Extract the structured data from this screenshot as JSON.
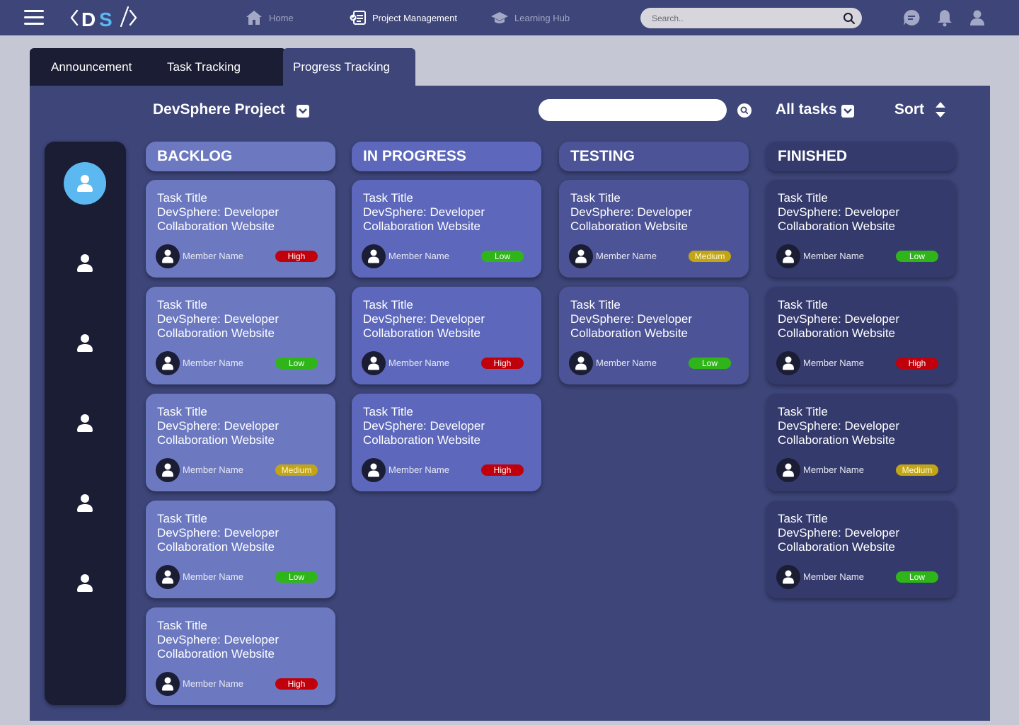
{
  "header": {
    "nav": [
      {
        "label": "Home",
        "icon": "home-icon",
        "active": false
      },
      {
        "label": "Project Management",
        "icon": "project-management-icon",
        "active": true
      },
      {
        "label": "Learning Hub",
        "icon": "graduation-cap-icon",
        "active": false
      }
    ],
    "search_placeholder": "Search.."
  },
  "tabs": [
    {
      "label": "Announcement",
      "active": false
    },
    {
      "label": "Task Tracking",
      "active": false
    },
    {
      "label": "Progress Tracking",
      "active": true
    }
  ],
  "board": {
    "project": "DevSphere Project",
    "search_value": "",
    "filter": "All tasks",
    "sort": "Sort"
  },
  "colors": {
    "high": "#c0000b",
    "low": "#2fb51a",
    "medium": "#c2a517",
    "accent": "#5bb8f0"
  },
  "columns": [
    {
      "name": "BACKLOG",
      "cards": [
        {
          "title": "Task Title",
          "desc": "DevSphere: Developer Collaboration Website",
          "member": "Member Name",
          "priority": "High"
        },
        {
          "title": "Task Title",
          "desc": "DevSphere: Developer Collaboration Website",
          "member": "Member Name",
          "priority": "Low"
        },
        {
          "title": "Task Title",
          "desc": "DevSphere: Developer Collaboration Website",
          "member": "Member Name",
          "priority": "Medium"
        },
        {
          "title": "Task Title",
          "desc": "DevSphere: Developer Collaboration Website",
          "member": "Member Name",
          "priority": "Low"
        },
        {
          "title": "Task Title",
          "desc": "DevSphere: Developer Collaboration Website",
          "member": "Member Name",
          "priority": "High"
        }
      ]
    },
    {
      "name": "IN PROGRESS",
      "cards": [
        {
          "title": "Task Title",
          "desc": "DevSphere: Developer Collaboration Website",
          "member": "Member Name",
          "priority": "Low"
        },
        {
          "title": "Task Title",
          "desc": "DevSphere: Developer Collaboration Website",
          "member": "Member Name",
          "priority": "High"
        },
        {
          "title": "Task Title",
          "desc": "DevSphere: Developer Collaboration Website",
          "member": "Member Name",
          "priority": "High"
        }
      ]
    },
    {
      "name": "TESTING",
      "cards": [
        {
          "title": "Task Title",
          "desc": "DevSphere: Developer Collaboration Website",
          "member": "Member Name",
          "priority": "Medium"
        },
        {
          "title": "Task Title",
          "desc": "DevSphere: Developer Collaboration Website",
          "member": "Member Name",
          "priority": "Low"
        }
      ]
    },
    {
      "name": "FINISHED",
      "cards": [
        {
          "title": "Task Title",
          "desc": "DevSphere: Developer Collaboration Website",
          "member": "Member Name",
          "priority": "Low"
        },
        {
          "title": "Task Title",
          "desc": "DevSphere: Developer Collaboration Website",
          "member": "Member Name",
          "priority": "High"
        },
        {
          "title": "Task Title",
          "desc": "DevSphere: Developer Collaboration Website",
          "member": "Member Name",
          "priority": "Medium"
        },
        {
          "title": "Task Title",
          "desc": "DevSphere: Developer Collaboration Website",
          "member": "Member Name",
          "priority": "Low"
        }
      ]
    }
  ]
}
